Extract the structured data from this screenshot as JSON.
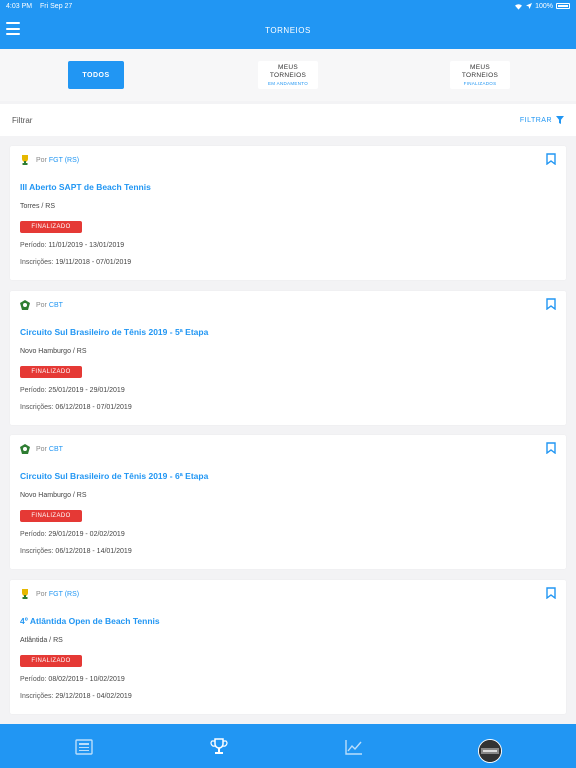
{
  "status_bar": {
    "time": "4:03 PM",
    "date": "Fri Sep 27",
    "battery": "100%"
  },
  "header": {
    "title": "TORNEIOS",
    "menu_icon": "hamburger-menu-icon"
  },
  "segments": {
    "todos": "TODOS",
    "andamento": {
      "line1": "MEUS",
      "line2": "TORNEIOS",
      "sub": "EM ANDAMENTO"
    },
    "finalizados": {
      "line1": "MEUS",
      "line2": "TORNEIOS",
      "sub": "FINALIZADOS"
    }
  },
  "filter": {
    "label": "Filtrar",
    "button": "FILTRAR",
    "icon": "filter-icon"
  },
  "labels": {
    "by": "Por",
    "periodo": "Período:",
    "inscricoes": "Inscrições:"
  },
  "tournaments": [
    {
      "org": "FGT (RS)",
      "title": "III Aberto SAPT de Beach Tennis",
      "city": "Torres / RS",
      "status": "FINALIZADO",
      "periodo": "11/01/2019 - 13/01/2019",
      "inscricoes": "19/11/2018 - 07/01/2019"
    },
    {
      "org": "CBT",
      "title": "Circuito Sul Brasileiro de Tênis 2019 - 5ª Etapa",
      "city": "Novo Hamburgo / RS",
      "status": "FINALIZADO",
      "periodo": "25/01/2019 - 29/01/2019",
      "inscricoes": "06/12/2018 - 07/01/2019"
    },
    {
      "org": "CBT",
      "title": "Circuito Sul Brasileiro de Tênis 2019 - 6ª Etapa",
      "city": "Novo Hamburgo / RS",
      "status": "FINALIZADO",
      "periodo": "29/01/2019 - 02/02/2019",
      "inscricoes": "06/12/2018 - 14/01/2019"
    },
    {
      "org": "FGT (RS)",
      "title": "4º Atlântida Open de Beach Tennis",
      "city": "Atlântida / RS",
      "status": "FINALIZADO",
      "periodo": "08/02/2019 - 10/02/2019",
      "inscricoes": "29/12/2018 - 04/02/2019"
    }
  ],
  "colors": {
    "primary": "#2196f3",
    "status_finalizado": "#e53935"
  },
  "tabbar": {
    "icons": [
      "news-icon",
      "trophy-icon",
      "chart-icon",
      "avatar-icon"
    ]
  }
}
